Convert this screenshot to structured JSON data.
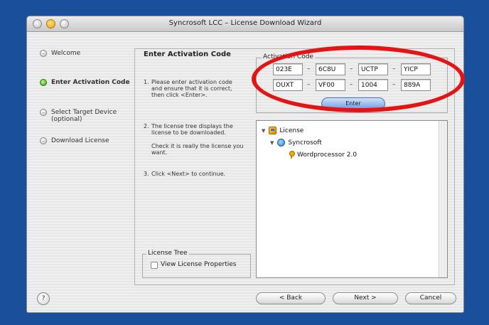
{
  "window": {
    "title": "Syncrosoft LCC – License Download Wizard"
  },
  "sidebar": {
    "items": [
      {
        "label": "Welcome",
        "state": "done"
      },
      {
        "label": "Enter Activation Code",
        "state": "current"
      },
      {
        "label": "Select Target Device\n(optional)",
        "state": "pending"
      },
      {
        "label": "Download License",
        "state": "pending"
      }
    ]
  },
  "main": {
    "heading": "Enter Activation Code",
    "instructions": [
      {
        "num": "1.",
        "text": "Please enter activation code and ensure that it is correct, then click <Enter>."
      },
      {
        "num": "2.",
        "text": "The license tree displays the license to be downloaded."
      },
      {
        "num": "",
        "text": "Check it is really the license you want."
      },
      {
        "num": "3.",
        "text": "Click <Next> to continue."
      }
    ],
    "activation": {
      "legend": "Activation Code",
      "row1": [
        "023E",
        "6C8U",
        "UCTP",
        "YICP"
      ],
      "row2": [
        "OUXT",
        "VF00",
        "1004",
        "889A"
      ],
      "separator": "–",
      "enter_label": "Enter"
    },
    "tree": [
      {
        "label": "License",
        "icon": "license-icon"
      },
      {
        "label": "Syncrosoft",
        "icon": "company-icon"
      },
      {
        "label": "Wordprocessor 2.0",
        "icon": "key-icon"
      }
    ],
    "license_tree_box": {
      "legend": "License Tree",
      "checkbox_label": "View License Properties",
      "checked": false
    }
  },
  "footer": {
    "help": "?",
    "back": "< Back",
    "next": "Next >",
    "cancel": "Cancel"
  },
  "colors": {
    "desktop": "#1a4f9c",
    "annotation": "#e41414",
    "current_step": "#3a9a1a"
  }
}
